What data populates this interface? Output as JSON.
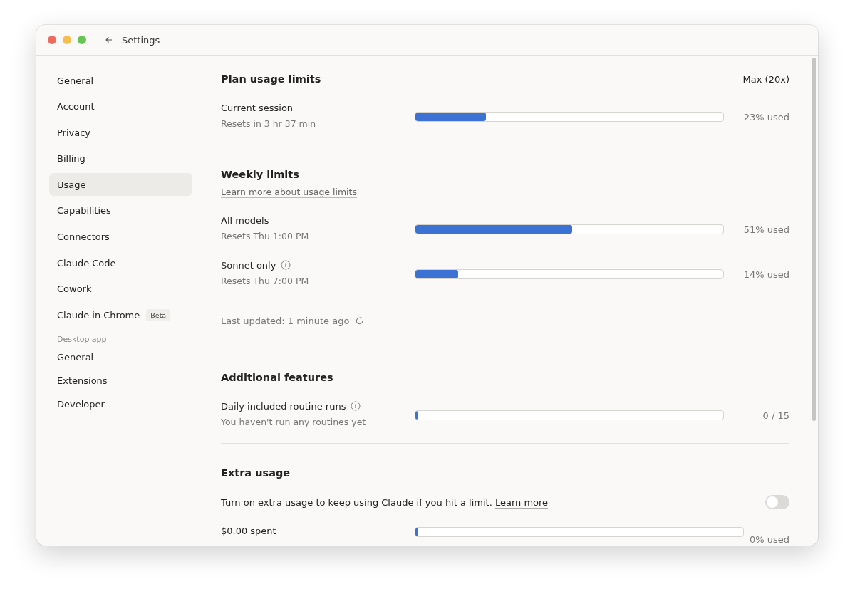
{
  "window": {
    "title": "Settings"
  },
  "sidebar": {
    "items": [
      {
        "label": "General",
        "selected": false
      },
      {
        "label": "Account",
        "selected": false
      },
      {
        "label": "Privacy",
        "selected": false
      },
      {
        "label": "Billing",
        "selected": false
      },
      {
        "label": "Usage",
        "selected": true
      },
      {
        "label": "Capabilities",
        "selected": false
      },
      {
        "label": "Connectors",
        "selected": false
      },
      {
        "label": "Claude Code",
        "selected": false
      },
      {
        "label": "Cowork",
        "selected": false
      },
      {
        "label": "Claude in Chrome",
        "selected": false,
        "badge": "Beta"
      }
    ],
    "group_heading": "Desktop app",
    "group_items": [
      {
        "label": "General",
        "selected": false
      },
      {
        "label": "Extensions",
        "selected": false
      },
      {
        "label": "Developer",
        "selected": false
      }
    ]
  },
  "sections": [
    {
      "title": "Plan usage limits",
      "plan": "Max (20x)",
      "rows": [
        {
          "kind": "meter",
          "label": "Current session",
          "info": false,
          "sub": "Resets in 3 hr 37 min",
          "level": 0.23,
          "reading": "23% used"
        }
      ]
    },
    {
      "title": "Weekly limits",
      "link": "Learn more about usage limits",
      "rows": [
        {
          "kind": "meter",
          "label": "All models",
          "info": false,
          "sub": "Resets Thu 1:00 PM",
          "level": 0.51,
          "reading": "51% used"
        },
        {
          "kind": "meter",
          "label": "Sonnet only",
          "info": true,
          "sub": "Resets Thu 7:00 PM",
          "level": 0.14,
          "reading": "14% used"
        },
        {
          "kind": "updated",
          "text": "Last updated: 1 minute ago"
        }
      ]
    },
    {
      "title": "Additional features",
      "rows": [
        {
          "kind": "meter",
          "label": "Daily included routine runs",
          "info": true,
          "sub": "You haven't run any routines yet",
          "level": 0,
          "reading": "0 / 15"
        }
      ]
    },
    {
      "title": "Extra usage",
      "rows": [
        {
          "kind": "toggle",
          "text": "Turn on extra usage to keep using Claude if you hit a limit.",
          "link": "Learn more",
          "on": false
        },
        {
          "kind": "meter",
          "label": "$0.00 spent",
          "info": false,
          "level": 0,
          "reading": "0% used",
          "wide": true
        }
      ]
    }
  ]
}
